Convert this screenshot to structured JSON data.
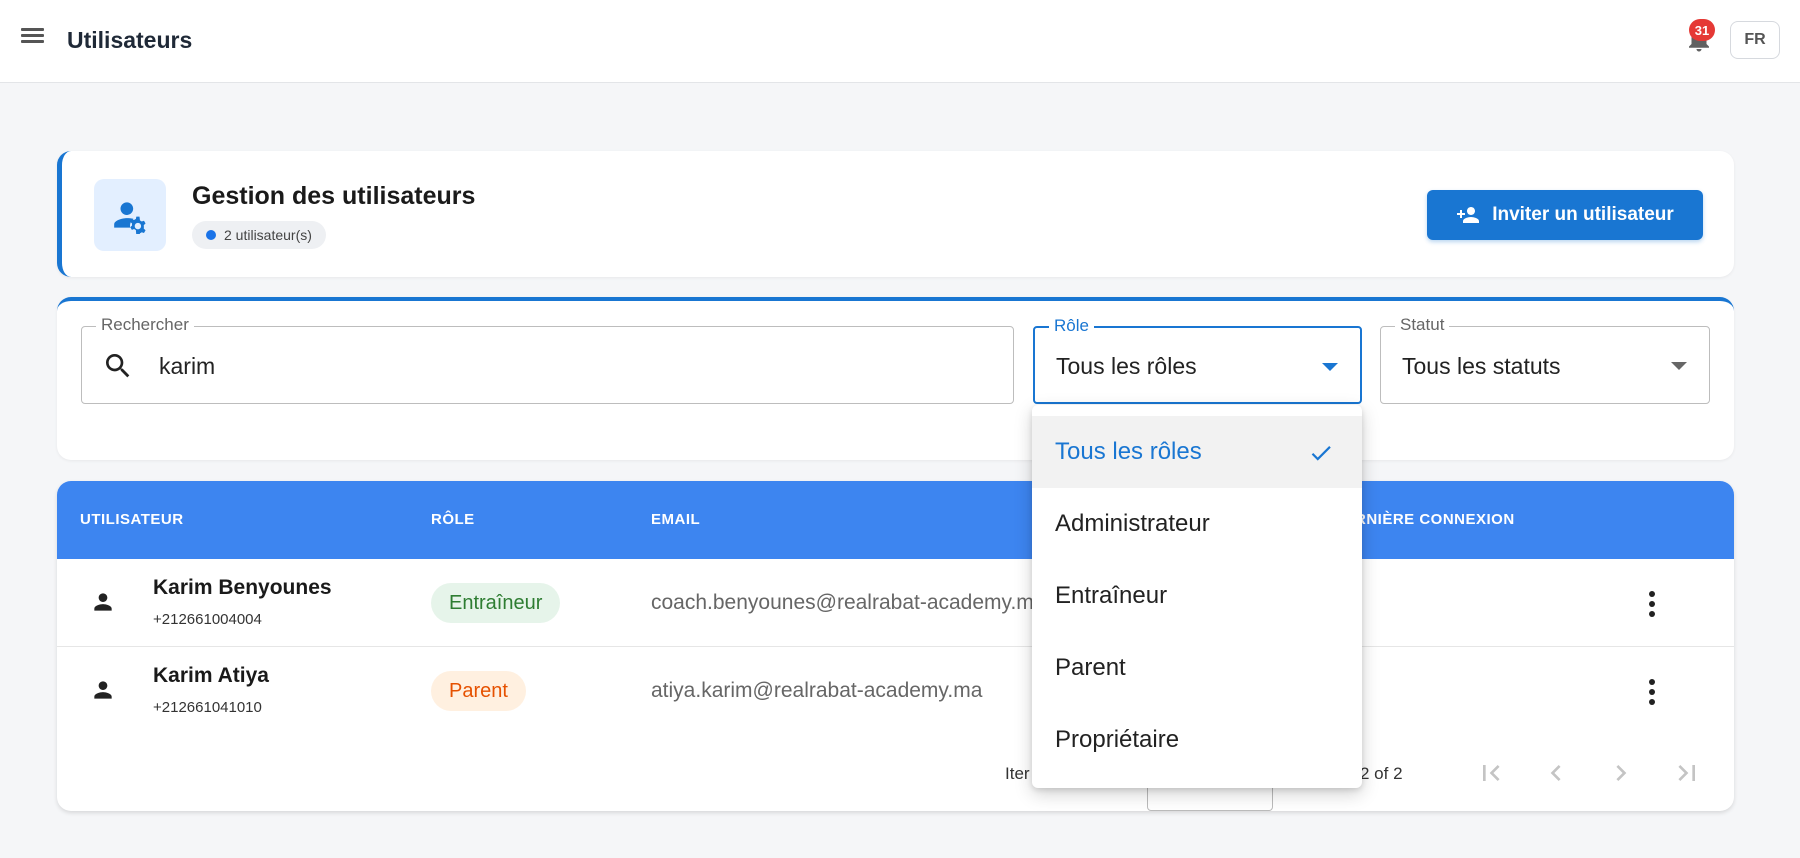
{
  "topbar": {
    "title": "Utilisateurs",
    "notification_count": "31",
    "language": "FR"
  },
  "header": {
    "title": "Gestion des utilisateurs",
    "user_count": "2 utilisateur(s)",
    "invite_label": "Inviter un utilisateur"
  },
  "filters": {
    "search": {
      "label": "Rechercher",
      "value": "karim"
    },
    "role": {
      "label": "Rôle",
      "value": "Tous les rôles"
    },
    "status": {
      "label": "Statut",
      "value": "Tous les statuts"
    }
  },
  "table": {
    "columns": [
      "UTILISATEUR",
      "RÔLE",
      "EMAIL",
      "RNIÈRE CONNEXION"
    ],
    "rows": [
      {
        "name": "Karim Benyounes",
        "phone": "+212661004004",
        "role": "Entraîneur",
        "email": "coach.benyounes@realrabat-academy.m"
      },
      {
        "name": "Karim Atiya",
        "phone": "+212661041010",
        "role": "Parent",
        "email": "atiya.karim@realrabat-academy.ma"
      }
    ],
    "pagination": {
      "items_label_partial": "Iter",
      "range_partial": "2 of 2"
    }
  },
  "role_menu": {
    "options": [
      "Tous les rôles",
      "Administrateur",
      "Entraîneur",
      "Parent",
      "Propriétaire"
    ],
    "selected": "Tous les rôles"
  },
  "colors": {
    "primary": "#1976d2",
    "table_header": "#3d85f0",
    "badge_red": "#e53935",
    "chip_coach_bg": "#e6f4ea",
    "chip_coach_text": "#2e7d32",
    "chip_parent_bg": "#fff0e0",
    "chip_parent_text": "#e65100"
  },
  "icons": {
    "menu": "menu-icon",
    "notifications": "bell-icon",
    "header": "user-gear-icon",
    "invite": "person-add-icon",
    "search": "search-icon",
    "user": "person-icon",
    "more": "more-vert-icon",
    "check": "check-icon"
  }
}
